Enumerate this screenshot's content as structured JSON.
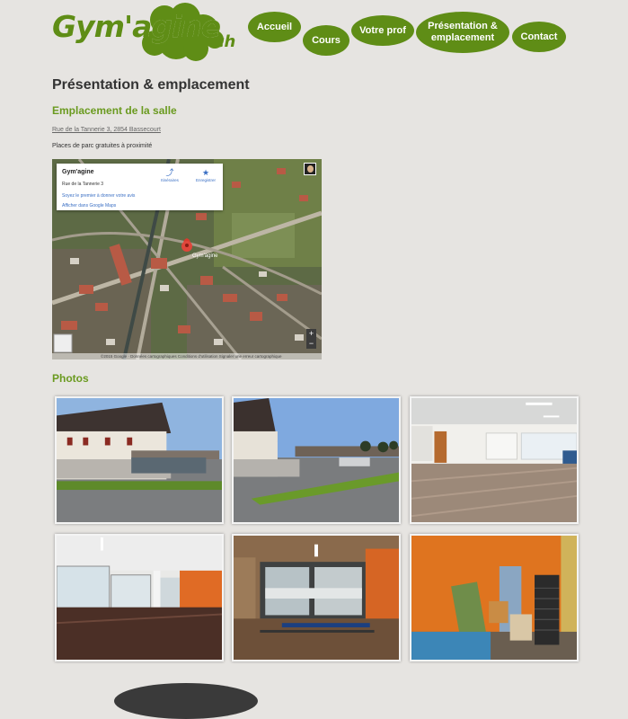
{
  "site": {
    "logo_main": "Gym'agine",
    "logo_suffix": ".ch"
  },
  "nav": [
    {
      "label": "Accueil"
    },
    {
      "label": "Cours"
    },
    {
      "label": "Votre prof"
    },
    {
      "label": "Présentation & emplacement"
    },
    {
      "label": "Contact"
    }
  ],
  "page": {
    "title": "Présentation & emplacement",
    "location_heading": "Emplacement de la salle",
    "address": "Rue de la Tannerie 3, 2854 Bassecourt",
    "parking": "Places de parc gratuites à proximité",
    "photos_heading": "Photos"
  },
  "map": {
    "place_name": "Gym'agine",
    "place_address": "Rue de la Tannerie 3",
    "review_link": "Soyez le premier à donner votre avis",
    "view_link": "Afficher dans Google Maps",
    "directions_label": "Itinéraires",
    "save_label": "Enregistrer",
    "marker_label": "Gym'agine",
    "zoom_in": "+",
    "zoom_out": "−",
    "footer": "©2015 Google · Données cartographiques  Conditions d'utilisation   Signaler une erreur cartographique"
  },
  "photos": [
    {
      "alt": "exterior-building"
    },
    {
      "alt": "exterior-parking"
    },
    {
      "alt": "hall-bright"
    },
    {
      "alt": "hall-windows"
    },
    {
      "alt": "entrance-doors"
    },
    {
      "alt": "storage-room"
    }
  ],
  "colors": {
    "brand": "#5f8d16",
    "heading": "#6a9a1f",
    "background": "#e6e4e1"
  }
}
